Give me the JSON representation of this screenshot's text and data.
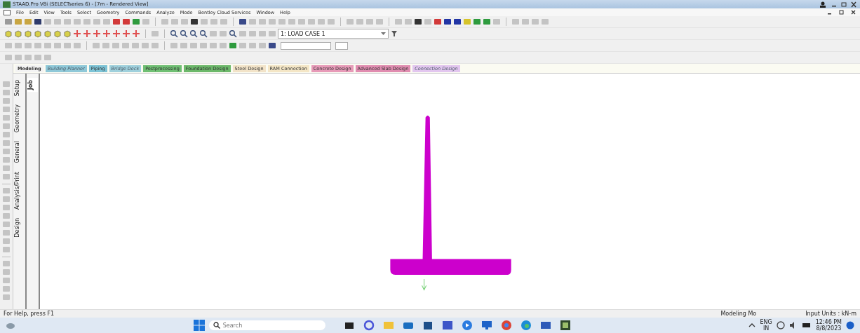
{
  "window": {
    "title": "STAAD.Pro V8i (SELECTseries 6) - [7m - Rendered View]"
  },
  "menu": [
    "File",
    "Edit",
    "View",
    "Tools",
    "Select",
    "Geometry",
    "Commands",
    "Analyze",
    "Mode",
    "Bentley Cloud Services",
    "Window",
    "Help"
  ],
  "load_case": {
    "value": "1: LOAD CASE 1"
  },
  "workflow_tabs": [
    {
      "label": "Modeling",
      "selected": true,
      "disabled": false,
      "color": "#f3f3f3"
    },
    {
      "label": "Building Planner",
      "selected": false,
      "disabled": true,
      "color": "#8fc8d8"
    },
    {
      "label": "Piping",
      "selected": false,
      "disabled": false,
      "color": "#7cc3d6"
    },
    {
      "label": "Bridge Deck",
      "selected": false,
      "disabled": true,
      "color": "#9fd0dc"
    },
    {
      "label": "Postprocessing",
      "selected": false,
      "disabled": false,
      "color": "#6fbf73"
    },
    {
      "label": "Foundation Design",
      "selected": false,
      "disabled": false,
      "color": "#6cb86a"
    },
    {
      "label": "Steel Design",
      "selected": false,
      "disabled": false,
      "color": "#f2e3c8"
    },
    {
      "label": "RAM Connection",
      "selected": false,
      "disabled": false,
      "color": "#f4e6c6"
    },
    {
      "label": "Concrete Design",
      "selected": false,
      "disabled": false,
      "color": "#e79ab8"
    },
    {
      "label": "Advanced Slab Design",
      "selected": false,
      "disabled": false,
      "color": "#e08cb0"
    },
    {
      "label": "Connection Design",
      "selected": false,
      "disabled": true,
      "color": "#e2c6ef"
    }
  ],
  "side_tabs": [
    {
      "label": "Setup",
      "selected": false
    },
    {
      "label": "Geometry",
      "selected": false
    },
    {
      "label": "General",
      "selected": false
    },
    {
      "label": "Analysis/Print",
      "selected": false
    },
    {
      "label": "Design",
      "selected": false
    }
  ],
  "sub_tabs": [
    {
      "label": "Job",
      "selected": true
    }
  ],
  "status_bar": {
    "help": "For Help, press F1",
    "mode": "Modeling Mo",
    "units": "Input Units : kN-m"
  },
  "taskbar": {
    "search": {
      "placeholder": "Search"
    },
    "language": "ENG",
    "region": "IN",
    "time": "12:46 PM",
    "date": "8/8/2023"
  }
}
